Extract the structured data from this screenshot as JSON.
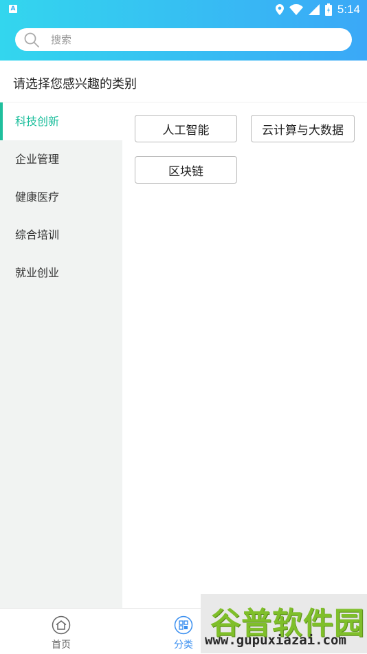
{
  "status_bar": {
    "app_icon_letter": "A",
    "time": "5:14"
  },
  "search": {
    "placeholder": "搜索"
  },
  "page_title": "请选择您感兴趣的类别",
  "sidebar": {
    "items": [
      {
        "label": "科技创新",
        "active": true
      },
      {
        "label": "企业管理",
        "active": false
      },
      {
        "label": "健康医疗",
        "active": false
      },
      {
        "label": "综合培训",
        "active": false
      },
      {
        "label": "就业创业",
        "active": false
      }
    ]
  },
  "tags": [
    {
      "label": "人工智能"
    },
    {
      "label": "云计算与大数据"
    },
    {
      "label": "区块链"
    }
  ],
  "bottom_nav": {
    "items": [
      {
        "label": "首页",
        "icon": "home-icon"
      },
      {
        "label": "分类",
        "icon": "category-icon",
        "active": true
      }
    ]
  },
  "watermark": {
    "title": "谷普软件园",
    "url": "www.gupuxiazai.com"
  },
  "colors": {
    "accent_green": "#1fbf9d",
    "accent_blue": "#3a8ff0",
    "header_start": "#33d6ee",
    "header_end": "#3aa8f7"
  }
}
